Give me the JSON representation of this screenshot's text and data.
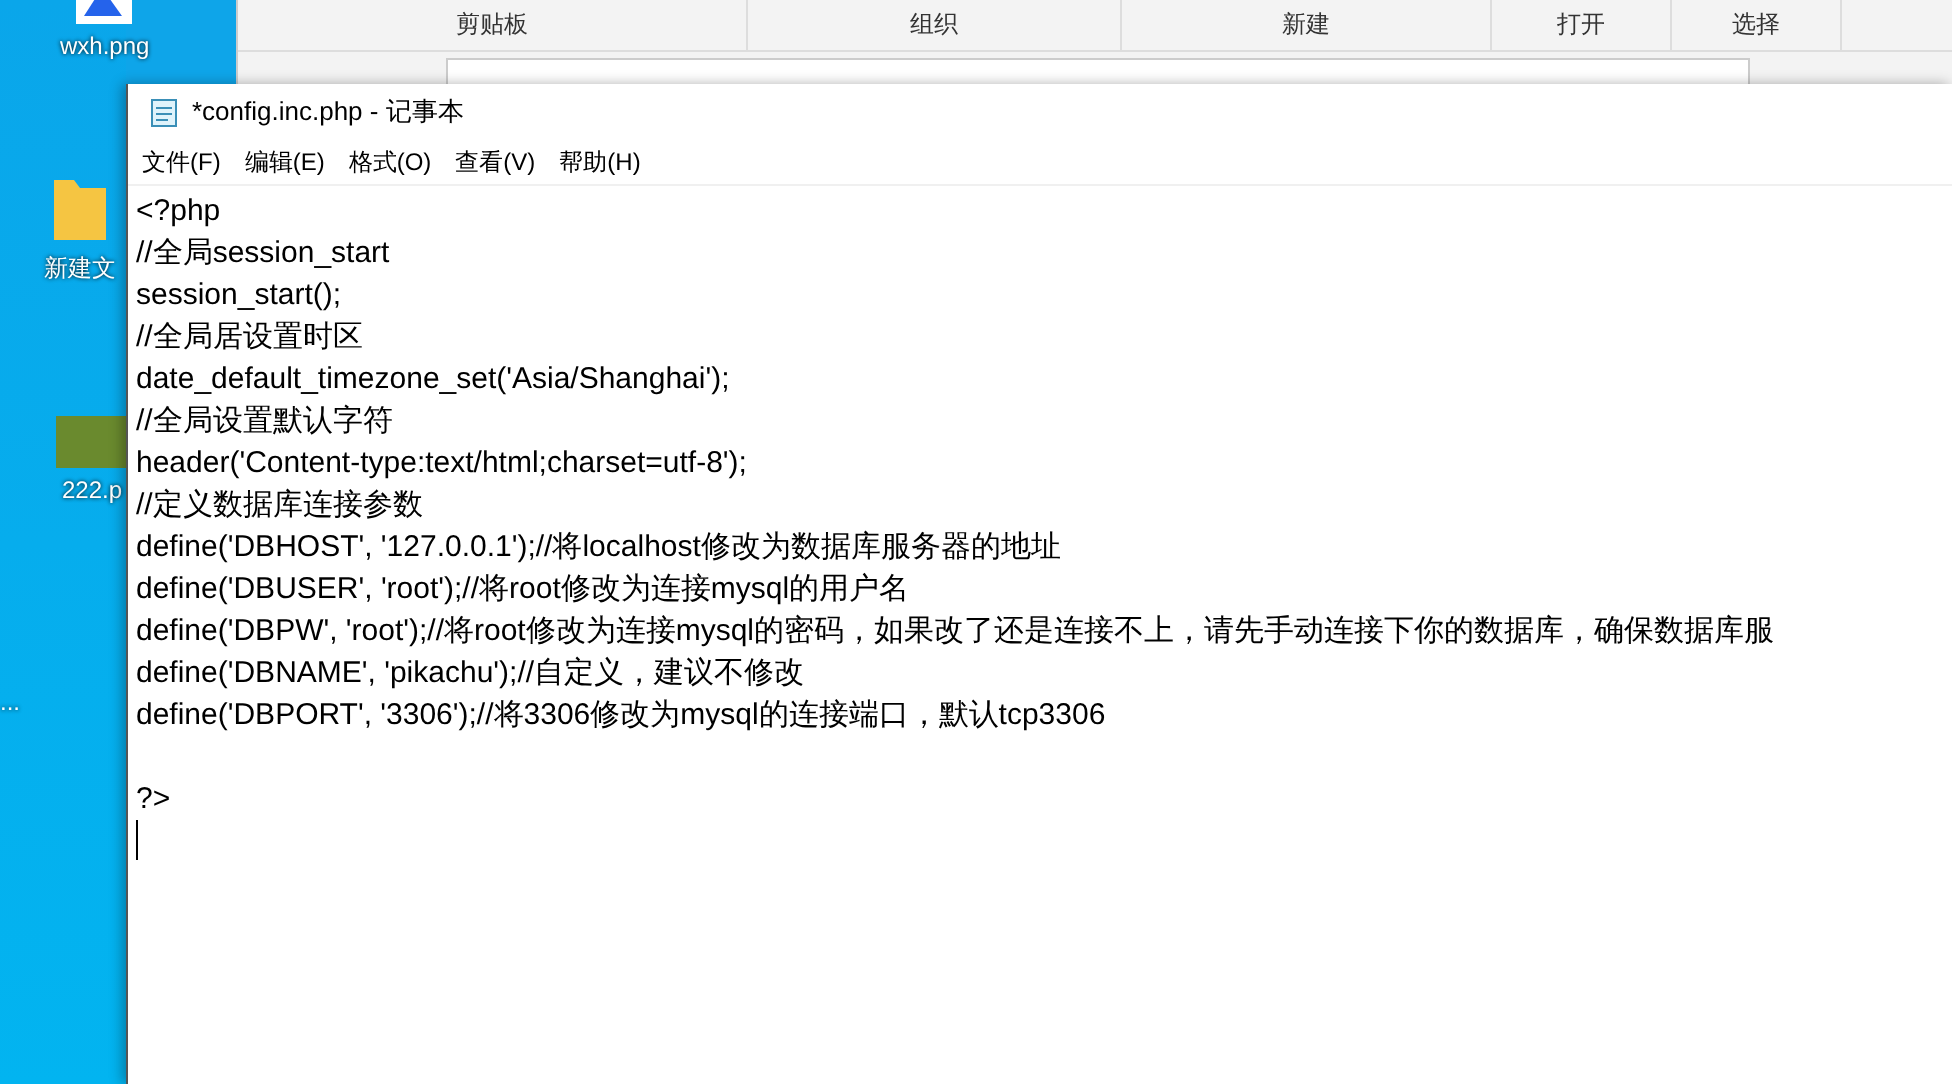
{
  "desktop": {
    "icons": [
      {
        "label": "wxh.png",
        "kind": "image"
      },
      {
        "label": "新建文",
        "kind": "folder"
      },
      {
        "label": "222.p",
        "kind": "photo"
      },
      {
        "label": "...",
        "kind": "more"
      }
    ]
  },
  "explorer": {
    "ribbon_groups": [
      "剪贴板",
      "组织",
      "新建",
      "打开",
      "选择"
    ]
  },
  "notepad": {
    "title": "*config.inc.php - 记事本",
    "menu": [
      "文件(F)",
      "编辑(E)",
      "格式(O)",
      "查看(V)",
      "帮助(H)"
    ],
    "lines": [
      "<?php",
      "//全局session_start",
      "session_start();",
      "//全局居设置时区",
      "date_default_timezone_set('Asia/Shanghai');",
      "//全局设置默认字符",
      "header('Content-type:text/html;charset=utf-8');",
      "//定义数据库连接参数",
      "define('DBHOST', '127.0.0.1');//将localhost修改为数据库服务器的地址",
      "define('DBUSER', 'root');//将root修改为连接mysql的用户名",
      "define('DBPW', 'root');//将root修改为连接mysql的密码，如果改了还是连接不上，请先手动连接下你的数据库，确保数据库服",
      "define('DBNAME', 'pikachu');//自定义，建议不修改",
      "define('DBPORT', '3306');//将3306修改为mysql的连接端口，默认tcp3306"
    ],
    "closing_lines": [
      "?>"
    ]
  }
}
